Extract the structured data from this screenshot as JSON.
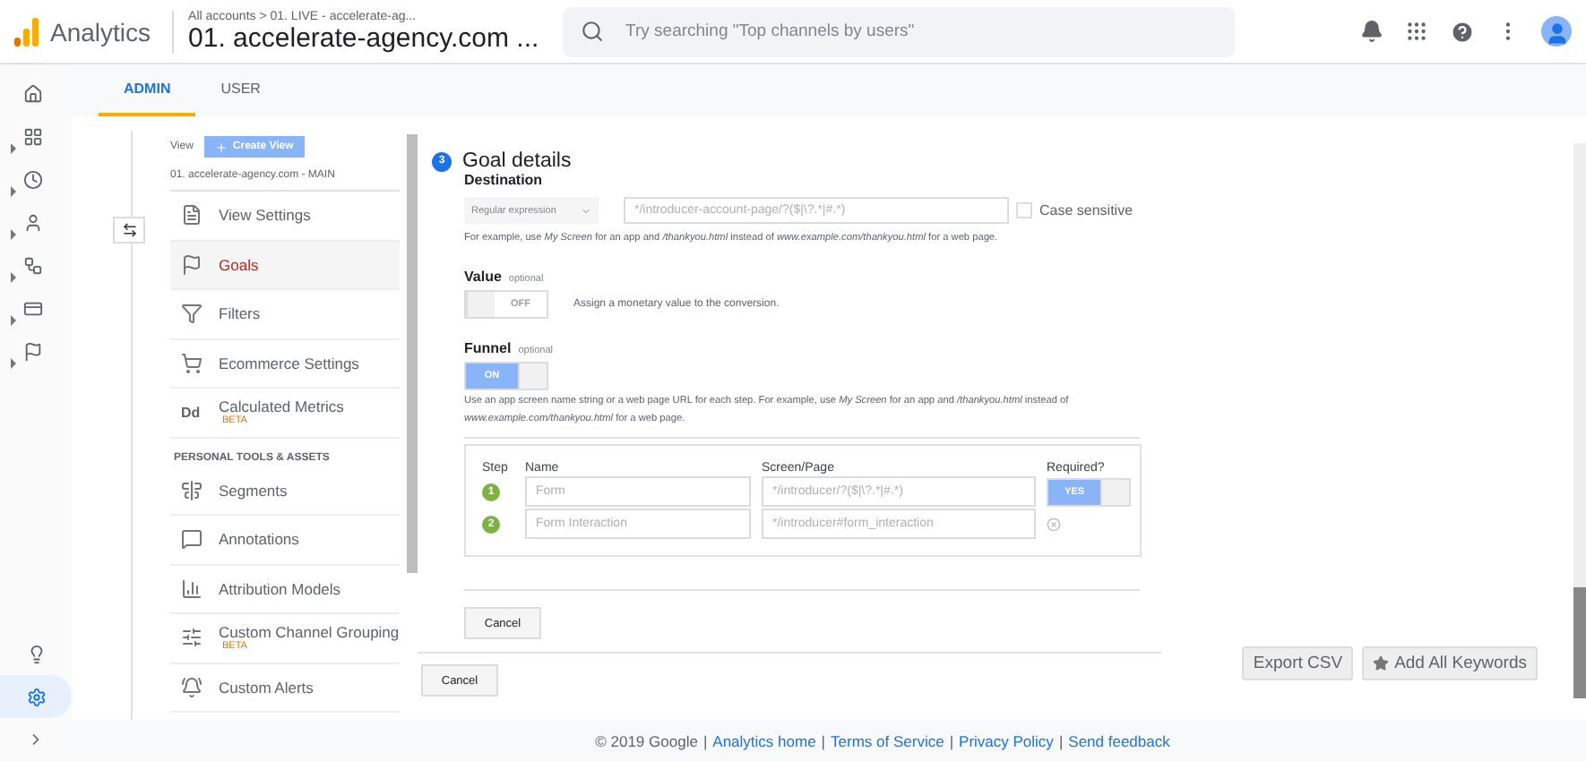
{
  "header": {
    "product": "Analytics",
    "breadcrumb": "All accounts > 01. LIVE - accelerate-ag...",
    "property": "01. accelerate-agency.com ...",
    "search_placeholder": "Try searching \"Top channels by users\""
  },
  "rail": [
    {
      "expandable": false,
      "selected": false
    },
    {
      "expandable": true,
      "selected": false
    },
    {
      "expandable": true,
      "selected": false
    },
    {
      "expandable": true,
      "selected": false
    },
    {
      "expandable": true,
      "selected": false
    },
    {
      "expandable": true,
      "selected": false
    },
    {
      "expandable": true,
      "selected": false
    }
  ],
  "rail_bottom": [
    {
      "selected": false
    },
    {
      "selected": true
    }
  ],
  "tabs": [
    {
      "label": "ADMIN",
      "selected": true
    },
    {
      "label": "USER",
      "selected": false
    }
  ],
  "view": {
    "label": "View",
    "create_button": "Create View",
    "name": "01. accelerate-agency.com - MAIN"
  },
  "admin_menu": [
    {
      "kind": "item",
      "label": "View Settings",
      "selected": false
    },
    {
      "kind": "item",
      "label": "Goals",
      "selected": true
    },
    {
      "kind": "item",
      "label": "Filters",
      "selected": false
    },
    {
      "kind": "item",
      "label": "Ecommerce Settings",
      "selected": false
    },
    {
      "kind": "item",
      "label": "Calculated Metrics",
      "badge": "BETA",
      "glyph": "Dd",
      "selected": false
    },
    {
      "kind": "section",
      "label": "PERSONAL TOOLS & ASSETS"
    },
    {
      "kind": "item",
      "label": "Segments",
      "selected": false
    },
    {
      "kind": "item",
      "label": "Annotations",
      "selected": false
    },
    {
      "kind": "item",
      "label": "Attribution Models",
      "selected": false
    },
    {
      "kind": "item",
      "label": "Custom Channel Grouping",
      "badge": "BETA",
      "selected": false
    },
    {
      "kind": "item",
      "label": "Custom Alerts",
      "selected": false
    }
  ],
  "goal": {
    "step": "3",
    "title": "Goal details",
    "destination": {
      "label": "Destination",
      "match_type": "Regular expression",
      "value": "*/introducer-account-page/?($|\\?.*|#.*)",
      "case_sensitive": {
        "label": "Case sensitive",
        "checked": false
      },
      "hint": "For example, use *My Screen* for an app and */thankyou.html* instead of *www.example.com/thankyou.html* for a web page."
    },
    "value": {
      "label": "Value",
      "optional": "optional",
      "toggle": {
        "on": false,
        "text": "OFF"
      },
      "description": "Assign a monetary value to the conversion."
    },
    "funnel": {
      "label": "Funnel",
      "optional": "optional",
      "toggle": {
        "on": true,
        "text": "ON"
      },
      "hint": "Use an app screen name string or a web page URL for each step. For example, use *My Screen* for an app and */thankyou.html* instead of *www.example.com/thankyou.html* for a web page.",
      "columns": [
        "Step",
        "Name",
        "Screen/Page",
        "Required?"
      ],
      "steps": [
        {
          "number": "1",
          "name": "Form",
          "screen": "*/introducer/?($|\\?.*|#.*)",
          "required": {
            "on": true,
            "text": "YES"
          }
        },
        {
          "number": "2",
          "name": "Form Interaction",
          "screen": "*/introducer#form_interaction"
        }
      ]
    },
    "cancel": "Cancel"
  },
  "outer_cancel": "Cancel",
  "actions": {
    "export": "Export CSV",
    "add_keywords": "Add All Keywords"
  },
  "footer": {
    "copyright": "© 2019 Google",
    "separator": "|",
    "links": [
      "Analytics home",
      "Terms of Service",
      "Privacy Policy",
      "Send feedback"
    ]
  }
}
